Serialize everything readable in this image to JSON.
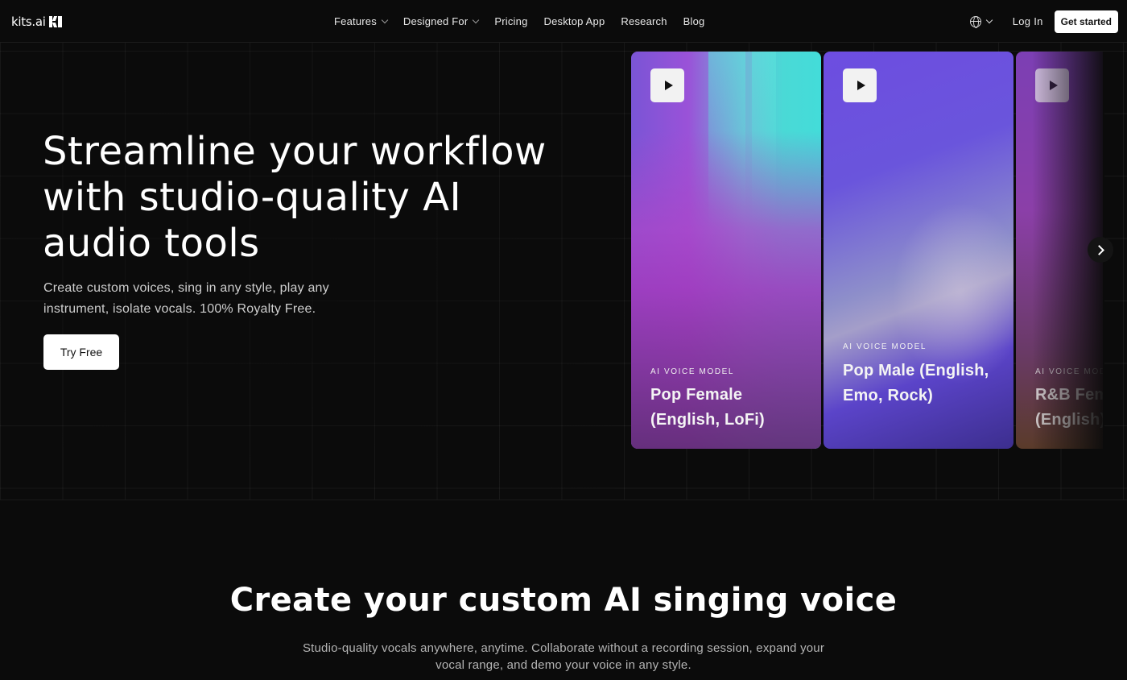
{
  "nav": {
    "logo_text": "kits.ai",
    "links": [
      {
        "label": "Features",
        "dropdown": true
      },
      {
        "label": "Designed For",
        "dropdown": true
      },
      {
        "label": "Pricing",
        "dropdown": false
      },
      {
        "label": "Desktop App",
        "dropdown": false
      },
      {
        "label": "Research",
        "dropdown": false
      },
      {
        "label": "Blog",
        "dropdown": false
      }
    ],
    "login_label": "Log In",
    "cta_label": "Get started"
  },
  "hero": {
    "title": "Streamline your workflow with studio-quality AI audio tools",
    "subtitle": "Create custom voices, sing in any style, play any instrument, isolate vocals. 100% Royalty Free.",
    "cta_label": "Try Free"
  },
  "cards": [
    {
      "label": "AI VOICE MODEL",
      "name": "Pop Female (English, LoFi)"
    },
    {
      "label": "AI VOICE MODEL",
      "name": "Pop Male (English, Emo, Rock)"
    },
    {
      "label": "AI VOICE MODEL",
      "name": "R&B Female (English)"
    }
  ],
  "section": {
    "title": "Create your custom AI singing voice",
    "subtitle": "Studio-quality vocals anywhere, anytime. Collaborate without a recording session, expand your vocal range, and demo your voice in any style."
  },
  "colors": {
    "background": "#0b0b0b",
    "text": "#ffffff",
    "muted_text": "#b4b4b4",
    "button_bg": "#ffffff"
  }
}
